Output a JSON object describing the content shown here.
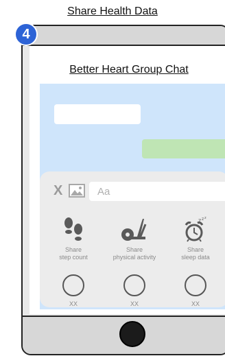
{
  "page": {
    "title": "Share Health Data"
  },
  "step": {
    "number": "4"
  },
  "chat": {
    "title": "Better Heart Group Chat"
  },
  "composer": {
    "close_glyph": "X",
    "placeholder": "Aa"
  },
  "share_options": [
    {
      "line1": "Share",
      "line2": "step count",
      "icon": "footprints-icon"
    },
    {
      "line1": "Share",
      "line2": "physical activity",
      "icon": "exercise-bike-icon"
    },
    {
      "line1": "Share",
      "line2": "sleep data",
      "icon": "alarm-clock-zzz-icon"
    }
  ],
  "empty_options": [
    {
      "label": "XX"
    },
    {
      "label": "XX"
    },
    {
      "label": "XX"
    }
  ],
  "colors": {
    "chat_background": "#cfe5fb",
    "outgoing_bubble": "#bfe5b4",
    "badge": "#2d63d6",
    "panel": "#ececec"
  }
}
